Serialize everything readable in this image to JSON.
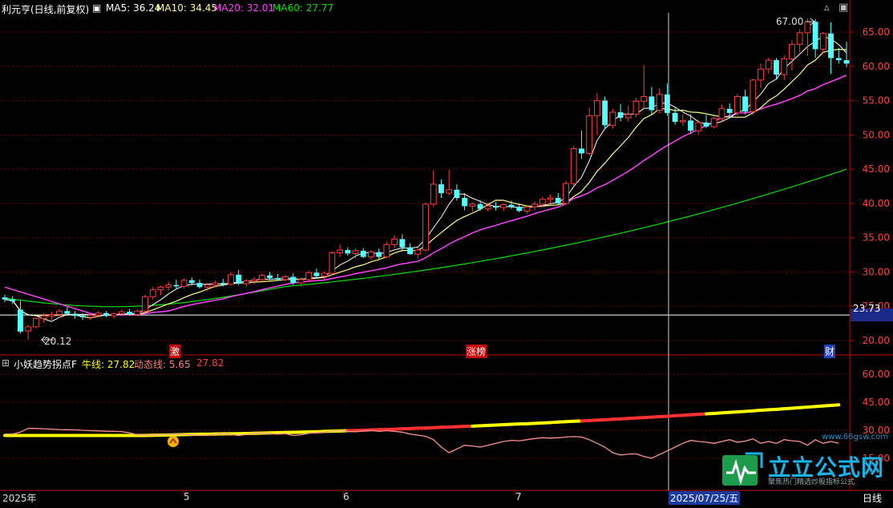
{
  "header": {
    "title": "利元亨(日线,前复权)",
    "ma5_label": "MA5: 36.24",
    "ma10_label": "MA10: 34.45",
    "ma20_label": "MA20: 32.01",
    "ma60_label": "MA60: 27.77"
  },
  "indicator": {
    "name": "小妖趋势拐点F",
    "bull_label": "牛线: 27.82",
    "dyn_label": "动态线: 5.65",
    "dyn_value2": "27.82"
  },
  "markers": {
    "high": "67.00",
    "low": "20.12",
    "current_price": "23.73",
    "tag1": "激",
    "tag2": "涨榜",
    "tag3": "财"
  },
  "time_axis": {
    "year": "2025年",
    "m5": "5",
    "m6": "6",
    "m7": "7",
    "crosshair_date": "2025/07/25/五",
    "right_label": "日线"
  },
  "watermark": {
    "brand": "立立公式网",
    "url": "www.66gsw.com",
    "slogan": "聚焦热门精选炒股指标公式"
  },
  "colors": {
    "up": "#ff3c3c",
    "down": "#54ffff",
    "ma5": "#ffffff",
    "ma10": "#ffff80",
    "ma20": "#ff40ff",
    "ma60": "#00e000",
    "axis": "#c00000"
  },
  "chart_data": [
    {
      "type": "candlestick",
      "title": "利元亨(日线,前复权)",
      "ylim": [
        18.5,
        68
      ],
      "yticks": [
        20,
        25,
        30,
        35,
        40,
        45,
        50,
        55,
        60,
        65
      ],
      "ohlc": [
        [
          26.3,
          26.7,
          25.6,
          26.0
        ],
        [
          26.0,
          26.5,
          25.3,
          25.7
        ],
        [
          24.5,
          25.8,
          21.0,
          21.3
        ],
        [
          21.4,
          22.3,
          20.12,
          22.0
        ],
        [
          22.0,
          23.4,
          21.8,
          23.2
        ],
        [
          23.2,
          24.0,
          22.6,
          23.6
        ],
        [
          23.6,
          24.2,
          23.0,
          23.8
        ],
        [
          23.8,
          24.6,
          23.3,
          24.3
        ],
        [
          24.3,
          24.9,
          23.6,
          23.9
        ],
        [
          23.9,
          24.3,
          23.2,
          23.6
        ],
        [
          23.6,
          24.0,
          23.0,
          23.4
        ],
        [
          23.4,
          23.9,
          23.0,
          23.7
        ],
        [
          23.7,
          24.3,
          23.3,
          24.0
        ],
        [
          24.0,
          24.3,
          23.4,
          23.6
        ],
        [
          23.6,
          24.1,
          23.2,
          23.9
        ],
        [
          23.9,
          24.5,
          23.5,
          24.2
        ],
        [
          24.2,
          24.6,
          23.6,
          23.8
        ],
        [
          23.8,
          24.5,
          23.5,
          24.3
        ],
        [
          24.3,
          26.7,
          24.1,
          26.4
        ],
        [
          26.4,
          27.8,
          26.0,
          27.4
        ],
        [
          27.4,
          28.0,
          26.6,
          27.8
        ],
        [
          27.8,
          28.6,
          27.3,
          28.1
        ],
        [
          28.1,
          28.9,
          27.5,
          27.9
        ],
        [
          27.9,
          29.1,
          27.6,
          28.8
        ],
        [
          28.8,
          29.2,
          28.0,
          28.4
        ],
        [
          28.4,
          28.9,
          27.6,
          27.8
        ],
        [
          27.8,
          28.4,
          27.2,
          28.1
        ],
        [
          28.1,
          28.7,
          27.7,
          28.4
        ],
        [
          28.4,
          29.0,
          27.9,
          28.2
        ],
        [
          28.2,
          30.0,
          28.0,
          29.6
        ],
        [
          29.6,
          30.3,
          28.1,
          28.3
        ],
        [
          28.3,
          29.0,
          27.8,
          28.7
        ],
        [
          28.7,
          29.3,
          28.2,
          28.9
        ],
        [
          28.9,
          29.8,
          28.4,
          29.5
        ],
        [
          29.5,
          30.0,
          28.9,
          29.1
        ],
        [
          29.1,
          29.7,
          28.7,
          28.9
        ],
        [
          28.9,
          29.6,
          28.6,
          29.3
        ],
        [
          29.3,
          29.8,
          28.1,
          28.4
        ],
        [
          28.4,
          29.2,
          27.9,
          28.9
        ],
        [
          28.9,
          30.2,
          28.6,
          29.9
        ],
        [
          29.9,
          30.5,
          29.1,
          29.4
        ],
        [
          29.4,
          30.1,
          28.9,
          29.8
        ],
        [
          29.8,
          33.0,
          29.6,
          32.8
        ],
        [
          32.8,
          34.0,
          32.2,
          33.2
        ],
        [
          33.2,
          33.6,
          32.4,
          32.7
        ],
        [
          32.7,
          33.5,
          32.0,
          33.1
        ],
        [
          33.1,
          33.5,
          32.0,
          32.2
        ],
        [
          32.2,
          33.2,
          31.8,
          32.9
        ],
        [
          32.9,
          33.4,
          31.9,
          32.2
        ],
        [
          32.2,
          34.4,
          32.0,
          34.0
        ],
        [
          34.0,
          35.4,
          33.5,
          34.8
        ],
        [
          34.8,
          35.5,
          33.0,
          33.6
        ],
        [
          33.6,
          34.2,
          32.5,
          32.6
        ],
        [
          32.6,
          33.6,
          32.0,
          33.2
        ],
        [
          33.2,
          40.1,
          33.0,
          39.9
        ],
        [
          39.9,
          44.8,
          39.5,
          42.8
        ],
        [
          42.8,
          43.5,
          40.8,
          41.5
        ],
        [
          41.5,
          44.9,
          41.2,
          42.0
        ],
        [
          42.0,
          42.8,
          40.4,
          40.8
        ],
        [
          40.8,
          41.5,
          39.0,
          39.6
        ],
        [
          39.6,
          40.2,
          38.8,
          39.9
        ],
        [
          39.9,
          40.5,
          38.9,
          39.2
        ],
        [
          39.2,
          40.1,
          38.8,
          39.6
        ],
        [
          39.6,
          40.2,
          39.0,
          39.4
        ],
        [
          39.4,
          40.0,
          38.9,
          39.8
        ],
        [
          39.8,
          40.4,
          39.2,
          39.5
        ],
        [
          39.5,
          40.0,
          38.7,
          38.9
        ],
        [
          38.9,
          39.8,
          38.5,
          39.5
        ],
        [
          39.5,
          40.3,
          39.0,
          39.9
        ],
        [
          39.9,
          41.0,
          39.4,
          40.6
        ],
        [
          40.6,
          41.3,
          40.0,
          40.8
        ],
        [
          40.8,
          41.5,
          39.8,
          40.0
        ],
        [
          40.0,
          43.3,
          39.7,
          42.9
        ],
        [
          42.9,
          48.4,
          42.5,
          48.0
        ],
        [
          48.0,
          50.6,
          46.5,
          47.3
        ],
        [
          47.3,
          54.0,
          47.0,
          52.8
        ],
        [
          52.8,
          56.1,
          50.0,
          55.0
        ],
        [
          55.0,
          55.6,
          50.8,
          51.4
        ],
        [
          51.4,
          53.8,
          50.9,
          53.3
        ],
        [
          53.3,
          54.5,
          52.0,
          52.5
        ],
        [
          52.5,
          54.3,
          51.9,
          53.0
        ],
        [
          53.0,
          55.4,
          52.6,
          54.9
        ],
        [
          54.9,
          60.2,
          54.0,
          55.6
        ],
        [
          55.6,
          57.0,
          53.0,
          53.6
        ],
        [
          53.6,
          56.8,
          53.2,
          55.9
        ],
        [
          55.9,
          57.5,
          52.8,
          53.2
        ],
        [
          53.2,
          54.0,
          51.5,
          51.9
        ],
        [
          51.9,
          53.0,
          51.3,
          52.1
        ],
        [
          52.1,
          53.0,
          50.2,
          50.6
        ],
        [
          50.6,
          52.2,
          50.1,
          51.8
        ],
        [
          51.8,
          52.9,
          51.0,
          51.2
        ],
        [
          51.2,
          52.6,
          50.9,
          52.4
        ],
        [
          52.4,
          54.4,
          52.0,
          53.8
        ],
        [
          53.8,
          54.6,
          52.5,
          53.2
        ],
        [
          53.2,
          56.0,
          52.8,
          55.6
        ],
        [
          55.6,
          56.6,
          53.0,
          53.4
        ],
        [
          53.4,
          58.2,
          53.0,
          58.0
        ],
        [
          58.0,
          60.4,
          56.8,
          59.6
        ],
        [
          59.6,
          61.3,
          58.9,
          60.9
        ],
        [
          60.9,
          61.2,
          58.2,
          58.8
        ],
        [
          58.8,
          61.6,
          58.0,
          61.1
        ],
        [
          61.1,
          63.8,
          59.4,
          63.2
        ],
        [
          63.2,
          65.4,
          62.0,
          64.9
        ],
        [
          64.9,
          67.0,
          61.5,
          66.5
        ],
        [
          66.5,
          66.9,
          61.2,
          62.5
        ],
        [
          62.5,
          65.0,
          61.8,
          64.8
        ],
        [
          64.8,
          66.4,
          58.9,
          61.2
        ],
        [
          61.2,
          62.7,
          60.4,
          60.9
        ],
        [
          60.9,
          63.6,
          59.9,
          60.4
        ]
      ],
      "ma5": [
        26.2,
        26.0,
        25.0,
        24.0,
        23.1,
        22.9,
        23.2,
        23.4,
        23.8,
        23.8,
        23.8,
        23.7,
        23.7,
        23.7,
        23.7,
        23.8,
        23.9,
        23.9,
        24.5,
        25.2,
        26.0,
        26.8,
        27.5,
        28.0,
        28.1,
        28.2,
        28.2,
        28.3,
        28.2,
        28.5,
        28.6,
        28.6,
        28.7,
        29.0,
        29.0,
        29.0,
        29.1,
        29.0,
        29.0,
        29.1,
        29.2,
        29.3,
        30.0,
        30.9,
        31.6,
        32.3,
        32.8,
        32.8,
        32.6,
        32.9,
        33.4,
        33.5,
        33.4,
        33.6,
        34.6,
        36.5,
        38.0,
        39.9,
        41.4,
        41.3,
        40.8,
        40.1,
        39.8,
        39.6,
        39.6,
        39.5,
        39.4,
        39.4,
        39.5,
        39.8,
        40.1,
        40.3,
        40.8,
        42.4,
        44.2,
        46.5,
        49.2,
        50.9,
        51.8,
        53.0,
        53.2,
        53.3,
        54.1,
        54.3,
        54.3,
        54.2,
        53.3,
        52.7,
        51.9,
        51.9,
        51.6,
        51.7,
        52.1,
        52.4,
        53.1,
        53.6,
        54.9,
        56.0,
        57.1,
        58.3,
        59.7,
        60.5,
        61.6,
        62.9,
        63.6,
        63.8,
        63.3,
        62.8
      ]
    },
    {
      "type": "line",
      "title": "小妖趋势拐点F",
      "ylim": [
        15,
        65
      ],
      "yticks": [
        15,
        30,
        45,
        60
      ],
      "bull_line": [
        27.2,
        27.2,
        27.2,
        27.2,
        27.2,
        27.2,
        27.2,
        27.2,
        27.2,
        27.2,
        27.2,
        27.2,
        27.2,
        27.2,
        27.2,
        27.2,
        27.2,
        27.2,
        27.2,
        27.3,
        27.4,
        27.5,
        27.6,
        27.7,
        27.8,
        27.9,
        27.9,
        28.0,
        28.1,
        28.1,
        28.2,
        28.3,
        28.4,
        28.5,
        28.6,
        28.7,
        28.8,
        28.9,
        29.0,
        29.1,
        29.2,
        29.4,
        29.5,
        29.6,
        29.8,
        29.9,
        30.0,
        30.2,
        30.3,
        30.5,
        30.6,
        30.8,
        30.9,
        31.1,
        31.2,
        31.4,
        31.6,
        31.7,
        31.9,
        32.1,
        32.2,
        32.4,
        32.6,
        32.8,
        33.0,
        33.2,
        33.4,
        33.5,
        33.7,
        33.9,
        34.1,
        34.4,
        34.6,
        34.8,
        35.0,
        35.2,
        35.4,
        35.6,
        35.9,
        36.1,
        36.3,
        36.6,
        36.8,
        37.0,
        37.3,
        37.5,
        37.8,
        38.0,
        38.3,
        38.5,
        38.8,
        39.0,
        39.3,
        39.6,
        39.8,
        40.1,
        40.4,
        40.7,
        41.0,
        41.2,
        41.5,
        41.8,
        42.1,
        42.4,
        42.7,
        43.0,
        43.3,
        43.6
      ],
      "dynamic_line": [
        28,
        28,
        29,
        31,
        31,
        30.8,
        30.6,
        30.4,
        30.3,
        30.2,
        30.0,
        29.8,
        29.7,
        29.5,
        29.4,
        29.3,
        28.6,
        27.6,
        27.4,
        27.5,
        27.6,
        27.8,
        28.0,
        27.8,
        27.6,
        27.2,
        27.4,
        27.9,
        28.2,
        27.8,
        27.2,
        27.8,
        28.4,
        28.6,
        28.2,
        27.9,
        28.2,
        27.2,
        27.6,
        28.4,
        28.8,
        29.0,
        29.6,
        29.8,
        29.4,
        29.2,
        29.6,
        30.0,
        29.4,
        29.8,
        29.4,
        29.0,
        28.0,
        27.4,
        26.8,
        25.0,
        21.0,
        18.0,
        20.0,
        22.0,
        21.6,
        21.0,
        22.0,
        23.0,
        24.0,
        24.6,
        24.4,
        25.0,
        25.6,
        26.0,
        25.8,
        26.0,
        26.4,
        26.6,
        26.4,
        25.0,
        23.0,
        21.0,
        18.0,
        16.8,
        17.2,
        17.4,
        16.0,
        15.0,
        17.0,
        19.0,
        21.0,
        23.0,
        24.6,
        24.0,
        23.6,
        23.0,
        24.0,
        25.0,
        23.6,
        24.2,
        25.4,
        23.0,
        24.0,
        23.0,
        25.0,
        24.4,
        24.0,
        22.0,
        25.0,
        23.0,
        24.0,
        23.0
      ]
    }
  ]
}
